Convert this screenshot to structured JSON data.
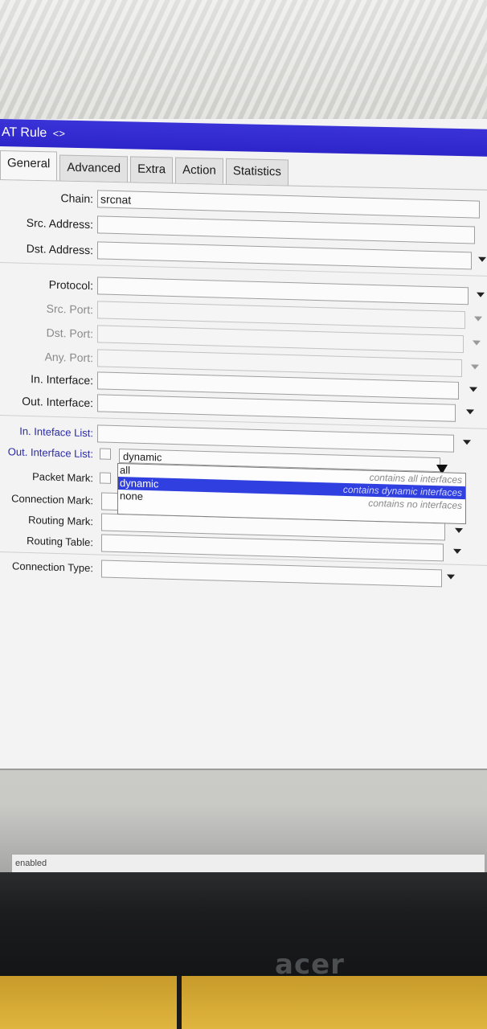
{
  "window": {
    "title": "AT Rule",
    "title_arrows": "<>",
    "tabs": [
      "General",
      "Advanced",
      "Extra",
      "Action",
      "Statistics"
    ],
    "active_tab": "General"
  },
  "form": {
    "chain": {
      "label": "Chain:",
      "value": "srcnat"
    },
    "src_address": {
      "label": "Src. Address:",
      "value": ""
    },
    "dst_address": {
      "label": "Dst. Address:",
      "value": ""
    },
    "protocol": {
      "label": "Protocol:",
      "value": ""
    },
    "src_port": {
      "label": "Src. Port:",
      "value": ""
    },
    "dst_port": {
      "label": "Dst. Port:",
      "value": ""
    },
    "any_port": {
      "label": "Any. Port:",
      "value": ""
    },
    "in_interface": {
      "label": "In. Interface:",
      "value": ""
    },
    "out_interface": {
      "label": "Out. Interface:",
      "value": ""
    },
    "in_interface_list": {
      "label": "In. Inteface List:",
      "value": ""
    },
    "out_interface_list": {
      "label": "Out. Interface List:",
      "value": "dynamic"
    },
    "packet_mark": {
      "label": "Packet Mark:",
      "value": ""
    },
    "connection_mark": {
      "label": "Connection Mark:",
      "value": ""
    },
    "routing_mark": {
      "label": "Routing Mark:",
      "value": ""
    },
    "routing_table": {
      "label": "Routing Table:",
      "value": ""
    },
    "connection_type": {
      "label": "Connection Type:",
      "value": ""
    }
  },
  "dropdown": {
    "options": [
      {
        "label": "all",
        "desc": "contains all interfaces"
      },
      {
        "label": "dynamic",
        "desc": "contains dynamic interfaces"
      },
      {
        "label": "none",
        "desc": "contains no interfaces"
      }
    ],
    "selected": "dynamic"
  },
  "status": {
    "text": "enabled"
  },
  "monitor": {
    "brand": "acer"
  },
  "colors": {
    "titlebar": "#2d25c9",
    "selection": "#2f3fe0",
    "blue_label": "#2a2aa8"
  }
}
